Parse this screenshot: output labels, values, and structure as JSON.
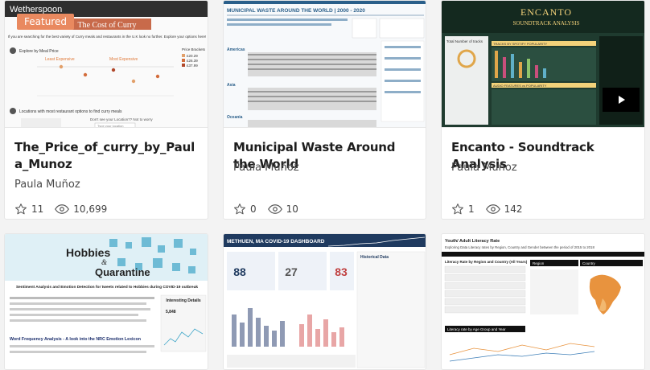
{
  "cards": [
    {
      "featured_label": "Featured",
      "title": "The_Price_of_curry_by_Paula_Munoz",
      "author": "Paula Muñoz",
      "favorites": "11",
      "views": "10,699",
      "thumbnail": {
        "header": "Wetherspoon",
        "heading": "The Cost of Curry",
        "subheading": "If you are searching for the best variety of Curry meals and restaurants in the U.K look no further. Explore your options here!",
        "step1": "Explore by Meal Price",
        "least_label": "Least Expensive",
        "most_label": "Most Expensive",
        "price_legend_title": "Price Brackets",
        "price_legend": [
          "£20.29",
          "£26.39",
          "£37.99"
        ],
        "step2": "Locations with most restaurant options to find curry meals",
        "search_placeholder": "Type your location",
        "hint": "Don't see your Location?? Not to worry"
      }
    },
    {
      "title": "Municipal Waste Around the World",
      "author": "Paula Muñoz",
      "favorites": "0",
      "views": "10",
      "thumbnail": {
        "heading": "MUNICIPAL WASTE AROUND THE WORLD | 2000 - 2020",
        "regions": [
          "Americas",
          "Asia",
          "Europe",
          "Oceania"
        ]
      }
    },
    {
      "title": "Encanto - Soundtrack Analysis",
      "author": "Paula Muñoz",
      "favorites": "1",
      "views": "142",
      "thumbnail": {
        "heading": "ENCANTO",
        "subheading": "SOUNDTRACK ANALYSIS",
        "panel1": "Total Number of tracks",
        "panel2": "TRACKS BY SPOTIFY POPULARITY",
        "panel3": "AUDIO FEATURES vs POPULARITY"
      }
    },
    {
      "thumbnail": {
        "heading1": "Hobbies",
        "heading2": "&",
        "heading3": "Quarantine",
        "subheading": "Sentiment Analysis and Emotion Detection for tweets related to Hobbies during COVID-19 outbreak",
        "details_title": "Interesting Details",
        "details_stat": "5,848",
        "section": "Word Frequency Analysis - A look into the NRC Emotion Lexicon"
      }
    },
    {
      "thumbnail": {
        "heading": "METHUEN, MA COVID-19 DASHBOARD",
        "kpis": [
          "88",
          "27",
          "83"
        ],
        "tab": "Historical Data"
      }
    },
    {
      "thumbnail": {
        "heading": "Youth/ Adult Literacy Rate",
        "subheading": "Exploring Data Literacy rates by Region, Country and Gender between the period of 2015 to 2018",
        "panel1": "Literacy Rate by Region and Country (All Years)",
        "panel2": "Region",
        "panel3": "Country",
        "panel4": "Literacy rate by Age Group and Year"
      }
    }
  ]
}
